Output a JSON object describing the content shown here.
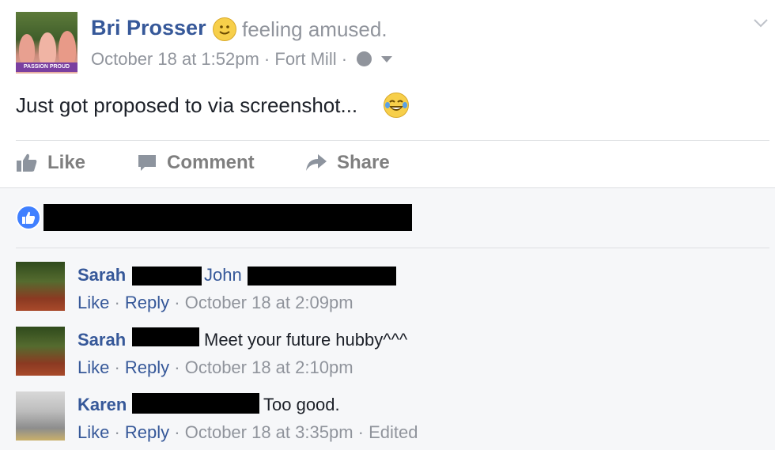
{
  "post": {
    "author": "Bri Prosser",
    "feeling": "feeling amused.",
    "timestamp": "October 18 at 1:52pm",
    "separator": "·",
    "location": "Fort Mill",
    "text": "Just got proposed to via screenshot...",
    "avatar_banner_text": "PASSION PROUD"
  },
  "actions": {
    "like": "Like",
    "comment": "Comment",
    "share": "Share"
  },
  "comments": [
    {
      "author": "Sarah",
      "tagged": "John",
      "text": "",
      "like": "Like",
      "reply": "Reply",
      "time": "October 18 at 2:09pm",
      "edited": ""
    },
    {
      "author": "Sarah",
      "tagged": "",
      "text": "Meet your future hubby^^^",
      "like": "Like",
      "reply": "Reply",
      "time": "October 18 at 2:10pm",
      "edited": ""
    },
    {
      "author": "Karen",
      "tagged": "",
      "text": "Too good.",
      "like": "Like",
      "reply": "Reply",
      "time": "October 18 at 3:35pm",
      "edited": "Edited"
    }
  ],
  "colors": {
    "link": "#365899",
    "meta": "#90949c",
    "like_blue": "#4080ff",
    "comment_bg": "#f6f7f9"
  }
}
